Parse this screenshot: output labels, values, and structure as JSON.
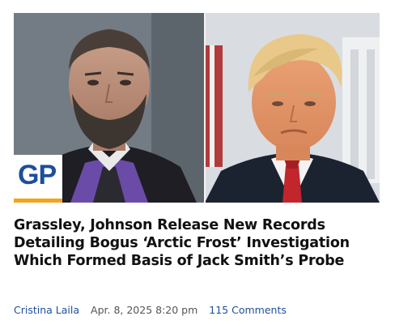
{
  "article": {
    "headline": "Grassley, Johnson Release New Records Detailing Bogus ‘Arctic Frost’ Investigation Which Formed Basis of Jack Smith’s Probe",
    "author": "Cristina Laila",
    "date": "Apr. 8, 2025 8:20 pm",
    "comments": "115 Comments"
  },
  "logo": {
    "text": "GP",
    "icon": "site-logo-icon"
  },
  "colors": {
    "link": "#1d4f9a",
    "meta_text": "#555555",
    "headline": "#111111",
    "logo_accent": "#f2a51a"
  }
}
